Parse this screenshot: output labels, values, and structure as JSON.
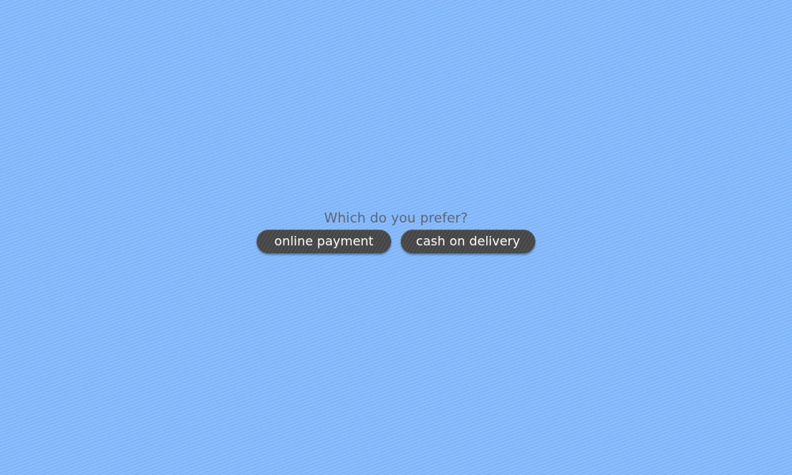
{
  "survey": {
    "question": "Which do you prefer?",
    "options": [
      {
        "label": "online payment"
      },
      {
        "label": "cash on delivery"
      }
    ]
  },
  "colors": {
    "background": "#7fb6fb",
    "button_background": "#454545",
    "button_text": "#ffffff",
    "prompt_text": "#5b6675"
  }
}
